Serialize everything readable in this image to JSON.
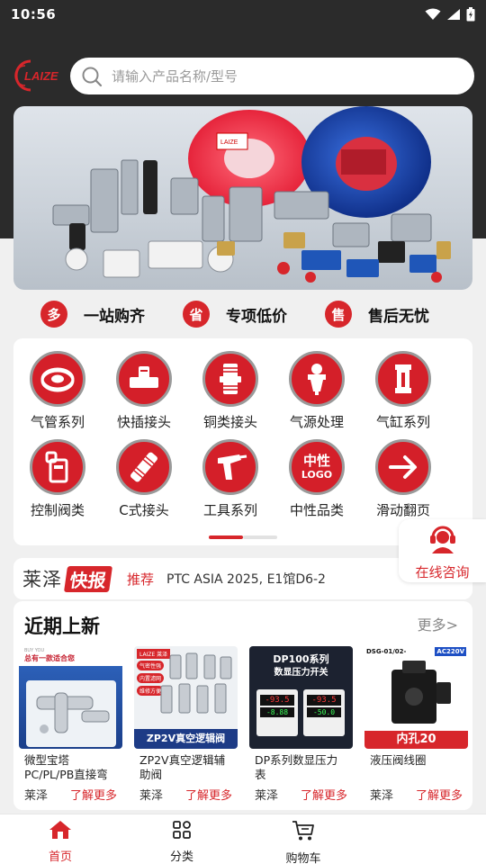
{
  "status_bar": {
    "time": "10:56"
  },
  "header": {
    "logo_text": "LAIZE",
    "search_placeholder": "请输入产品名称/型号"
  },
  "banner": {
    "brand_label": "LAIZE"
  },
  "promises": [
    {
      "badge": "多",
      "label": "一站购齐"
    },
    {
      "badge": "省",
      "label": "专项低价"
    },
    {
      "badge": "售",
      "label": "售后无忧"
    }
  ],
  "categories": [
    {
      "label": "气管系列",
      "icon": "tube-coil-icon"
    },
    {
      "label": "快插接头",
      "icon": "tee-fitting-icon"
    },
    {
      "label": "铜类接头",
      "icon": "brass-fitting-icon"
    },
    {
      "label": "气源处理",
      "icon": "air-filter-icon"
    },
    {
      "label": "气缸系列",
      "icon": "cylinder-icon"
    },
    {
      "label": "控制阀类",
      "icon": "valve-icon"
    },
    {
      "label": "C式接头",
      "icon": "coupler-icon"
    },
    {
      "label": "工具系列",
      "icon": "air-gun-icon"
    },
    {
      "label": "中性品类",
      "icon": "neutral-logo-icon",
      "icon_text_1": "中性",
      "icon_text_2": "LOGO"
    },
    {
      "label": "滑动翻页",
      "icon": "arrow-right-icon"
    }
  ],
  "news": {
    "brand": "莱泽",
    "tag": "快报",
    "recommend": "推荐",
    "headline": "PTC ASIA 2025, E1馆D6-2"
  },
  "float_consult": {
    "label": "在线咨询"
  },
  "recent": {
    "title": "近期上新",
    "more": "更多>",
    "products": [
      {
        "name": "微型宝塔PC/PL/PB直接弯头三...",
        "brand": "莱泽",
        "more": "了解更多",
        "img_caption": "总有一款适合您",
        "img_small": "BUY YOU"
      },
      {
        "name": "ZP2V真空逻辑辅助阀",
        "brand": "莱泽",
        "more": "了解更多",
        "img_caption": "ZP2V真空逻辑阀",
        "img_brand": "LAIZE 莱泽",
        "img_features": [
          "气密性强",
          "内置滤网",
          "维修方便"
        ]
      },
      {
        "name": "DP系列数显压力表",
        "brand": "莱泽",
        "more": "了解更多",
        "img_title_1": "DP100系列",
        "img_title_2": "数显压力开关",
        "img_reading_1": "-93.5",
        "img_reading_2": "-93.5",
        "img_sub_1": "-8.88",
        "img_sub_2": "-50.0"
      },
      {
        "name": "液压阀线圈",
        "brand": "莱泽",
        "more": "了解更多",
        "img_model": "DSG-01/02-",
        "img_voltage": "AC220V",
        "img_caption": "内孔20"
      }
    ]
  },
  "tabbar": [
    {
      "label": "首页",
      "active": true
    },
    {
      "label": "分类",
      "active": false
    },
    {
      "label": "购物车",
      "active": false
    }
  ],
  "colors": {
    "brand_red": "#d7262b",
    "header_dark": "#2b2b2b"
  }
}
